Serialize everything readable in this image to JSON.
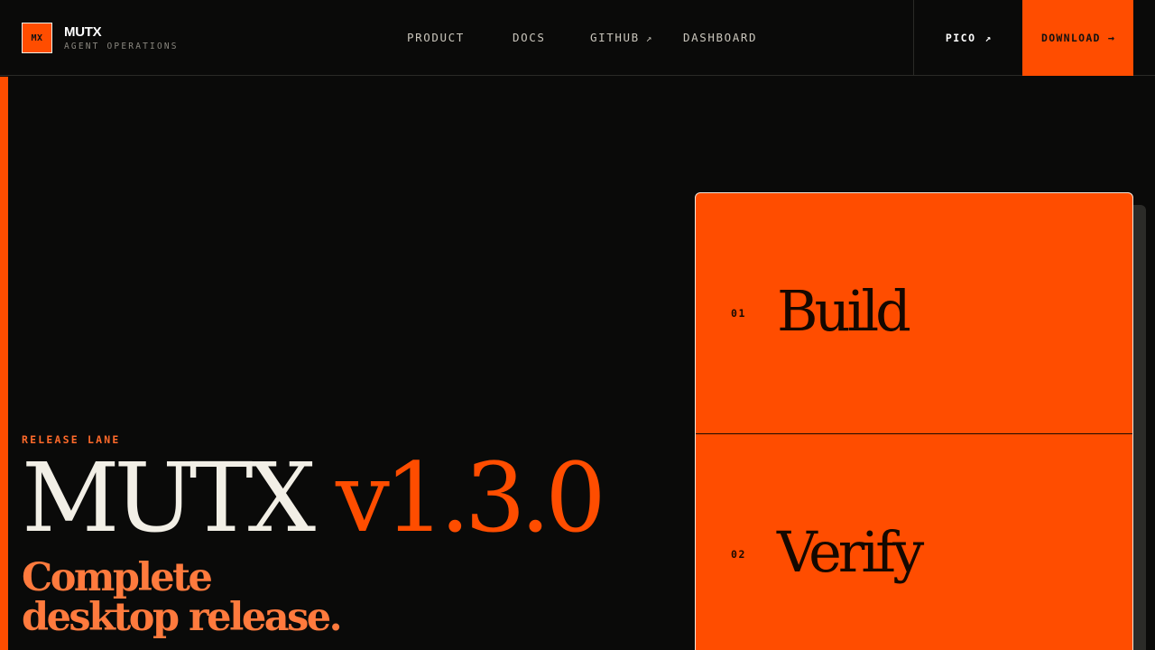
{
  "header": {
    "logo_mark": "MX",
    "brand_name": "MUTX",
    "brand_tagline": "AGENT OPERATIONS",
    "nav": [
      {
        "label": "PRODUCT"
      },
      {
        "label": "DOCS"
      },
      {
        "label": "GITHUB",
        "external_icon": "↗"
      },
      {
        "label": "DASHBOARD"
      }
    ],
    "pico": {
      "label": "PICO",
      "icon": "↗"
    },
    "download": {
      "label": "DOWNLOAD",
      "icon": "→"
    }
  },
  "hero": {
    "eyebrow": "RELEASE LANE",
    "title_name": "MUTX",
    "title_version": "v1.3.0",
    "subtitle_line1": "Complete",
    "subtitle_line2": "desktop release."
  },
  "stages": [
    {
      "number": "01",
      "label": "Build"
    },
    {
      "number": "02",
      "label": "Verify"
    }
  ],
  "colors": {
    "background": "#0a0a09",
    "accent": "#ff4d00",
    "subtitle": "#ff7a3d",
    "text": "#f2efe6"
  }
}
